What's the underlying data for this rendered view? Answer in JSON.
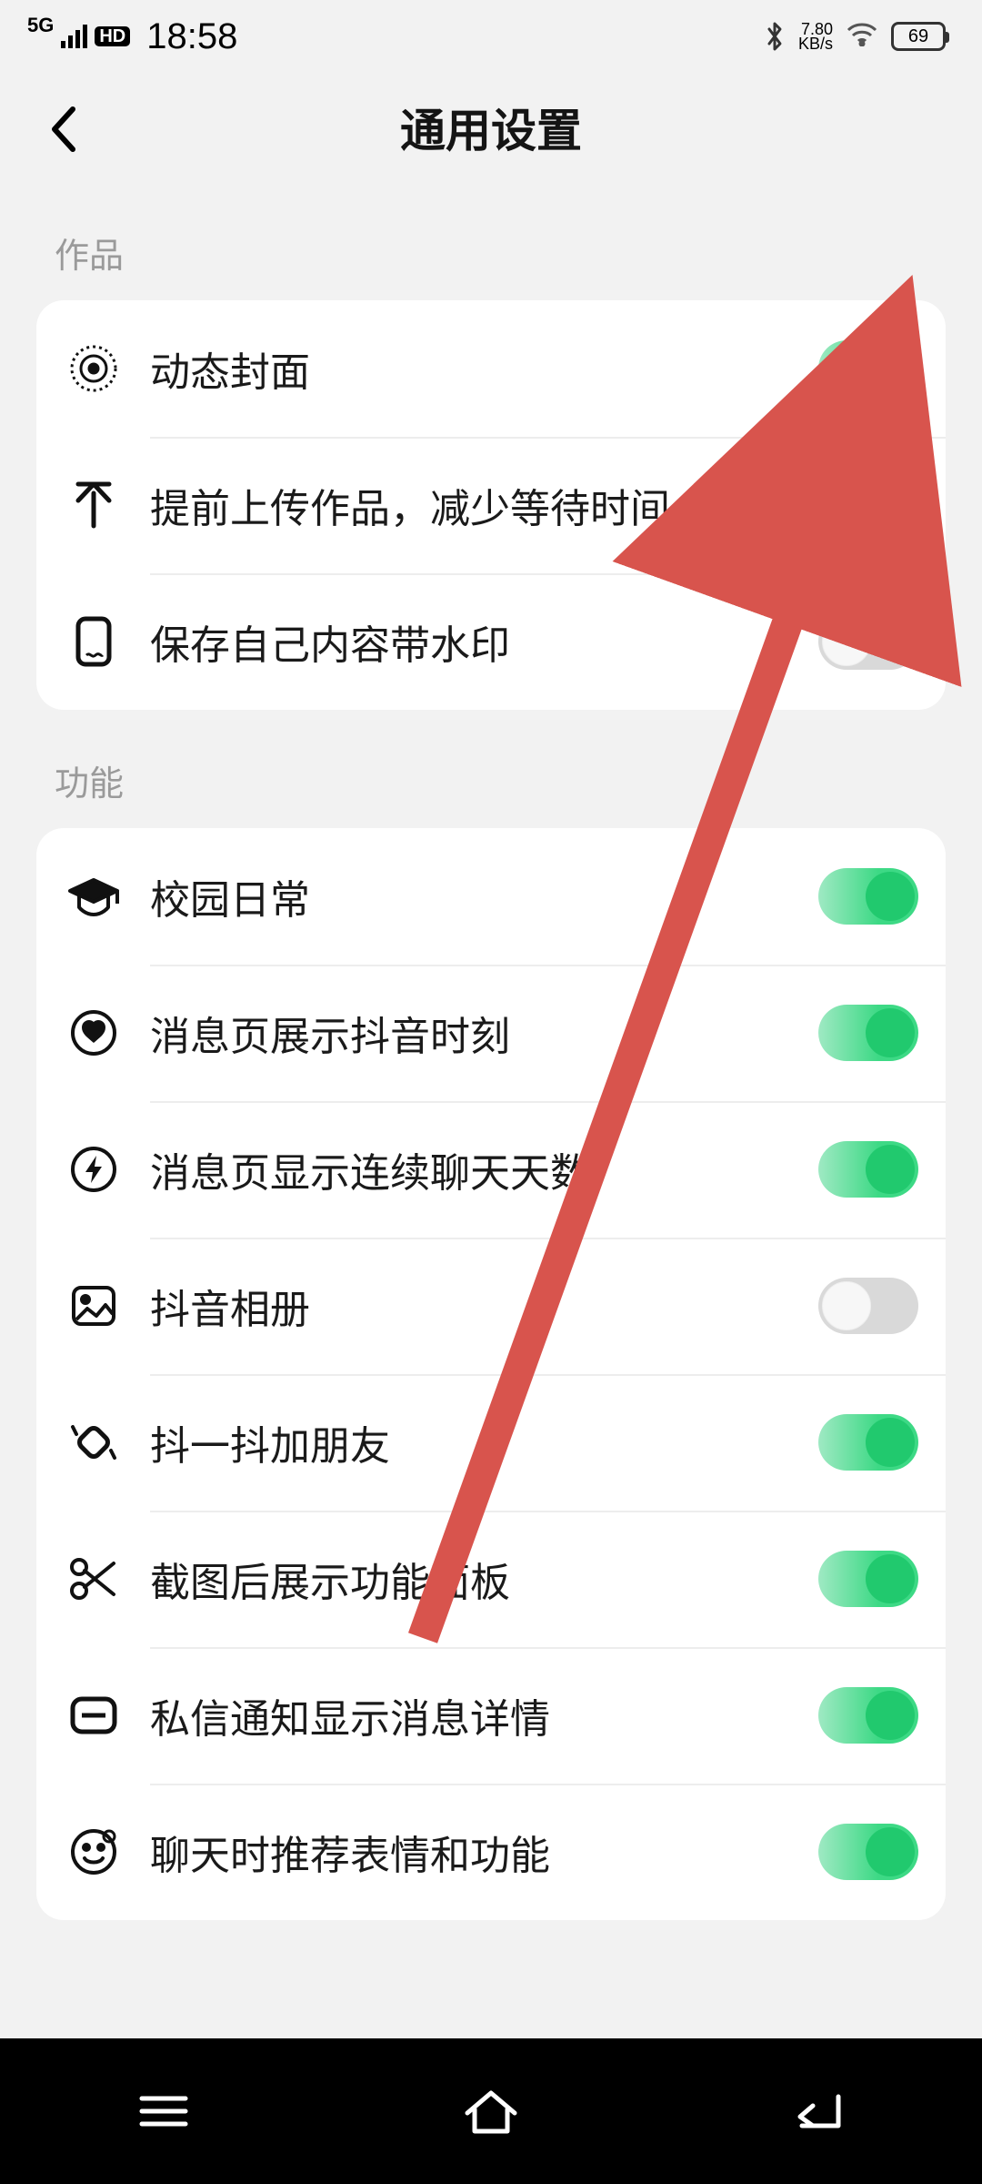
{
  "statusbar": {
    "network_type": "5G",
    "hd_badge": "HD",
    "time": "18:58",
    "net_speed_top": "7.80",
    "net_speed_bot": "KB/s",
    "battery": "69"
  },
  "header": {
    "title": "通用设置"
  },
  "sections": {
    "works_header": "作品",
    "features_header": "功能"
  },
  "rows": {
    "dynamic_cover": "动态封面",
    "pre_upload": "提前上传作品，减少等待时间",
    "save_watermark": "保存自己内容带水印",
    "campus_daily": "校园日常",
    "douyin_moment": "消息页展示抖音时刻",
    "chat_days": "消息页显示连续聊天天数",
    "douyin_album": "抖音相册",
    "shake_friend": "抖一抖加朋友",
    "screenshot_panel": "截图后展示功能面板",
    "dm_notify_detail": "私信通知显示消息详情",
    "chat_emoji_suggest": "聊天时推荐表情和功能"
  },
  "toggles": {
    "dynamic_cover": true,
    "pre_upload": true,
    "save_watermark": false,
    "campus_daily": true,
    "douyin_moment": true,
    "chat_days": true,
    "douyin_album": false,
    "shake_friend": true,
    "screenshot_panel": true,
    "dm_notify_detail": true,
    "chat_emoji_suggest": true
  },
  "colors": {
    "toggle_on": "#21C96E",
    "arrow": "#D8544D"
  }
}
